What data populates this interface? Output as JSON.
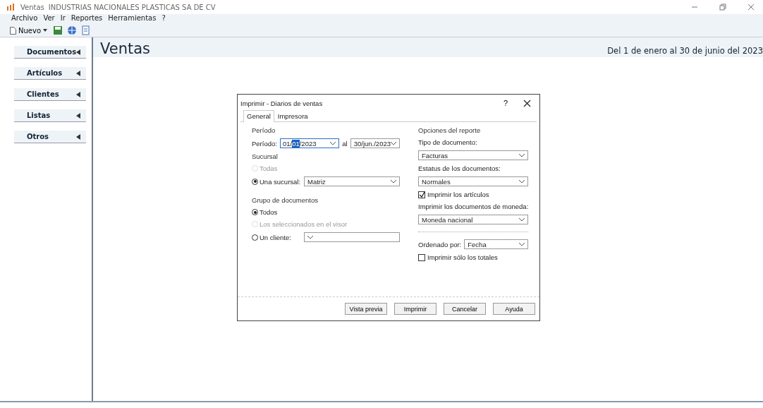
{
  "window": {
    "title": "Ventas",
    "company": "INDUSTRIAS NACIONALES PLASTICAS SA DE CV"
  },
  "menu": [
    "Archivo",
    "Ver",
    "Ir",
    "Reportes",
    "Herramientas",
    "?"
  ],
  "toolbar": {
    "new_button": "Nuevo"
  },
  "sidebar": {
    "items": [
      {
        "label": "Documentos"
      },
      {
        "label": "Artículos"
      },
      {
        "label": "Clientes"
      },
      {
        "label": "Listas"
      },
      {
        "label": "Otros"
      }
    ]
  },
  "content": {
    "heading": "Ventas",
    "date_range": "Del 1 de enero al 30 de junio del 2023"
  },
  "dialog": {
    "title": "Imprimir - Diarios de ventas",
    "help_button": "?",
    "tabs": [
      {
        "label": "General",
        "selected": true
      },
      {
        "label": "Impresora",
        "selected": false
      }
    ],
    "period": {
      "section": "Período",
      "label": "Período:",
      "from_parts": [
        {
          "text": "01/",
          "selected": false
        },
        {
          "text": "01",
          "selected": true
        },
        {
          "text": "/2023",
          "selected": false
        }
      ],
      "separator": "al",
      "to": "30/jun./2023"
    },
    "branch": {
      "section": "Sucursal",
      "options": [
        {
          "label": "Todas",
          "selected": false,
          "disabled": true
        },
        {
          "label": "Una sucursal:",
          "selected": true,
          "disabled": false,
          "kind": "dropdown",
          "dropdown": "Matriz"
        }
      ]
    },
    "group": {
      "section": "Grupo de documentos",
      "options": [
        {
          "label": "Todos",
          "selected": true,
          "disabled": false
        },
        {
          "label": "Los seleccionados en el visor",
          "selected": false,
          "disabled": true
        },
        {
          "label": "Un cliente:",
          "selected": false,
          "disabled": false,
          "kind": "dropdown"
        }
      ]
    },
    "options": {
      "section": "Opciones del reporte",
      "doc_type": {
        "label": "Tipo de documento:",
        "value": "Facturas"
      },
      "status": {
        "label": "Estatus de los documentos:",
        "value": "Normales"
      },
      "print_items": {
        "label": "Imprimir los artículos",
        "checked": true
      },
      "currency": {
        "label": "Imprimir los documentos de moneda:",
        "value": "Moneda nacional"
      },
      "order": {
        "label": "Ordenado por:",
        "value": "Fecha"
      },
      "totals_only": {
        "label": "Imprimir sólo los totales",
        "checked": false
      }
    },
    "buttons": [
      "Vista previa",
      "Imprimir",
      "Cancelar",
      "Ayuda"
    ]
  }
}
